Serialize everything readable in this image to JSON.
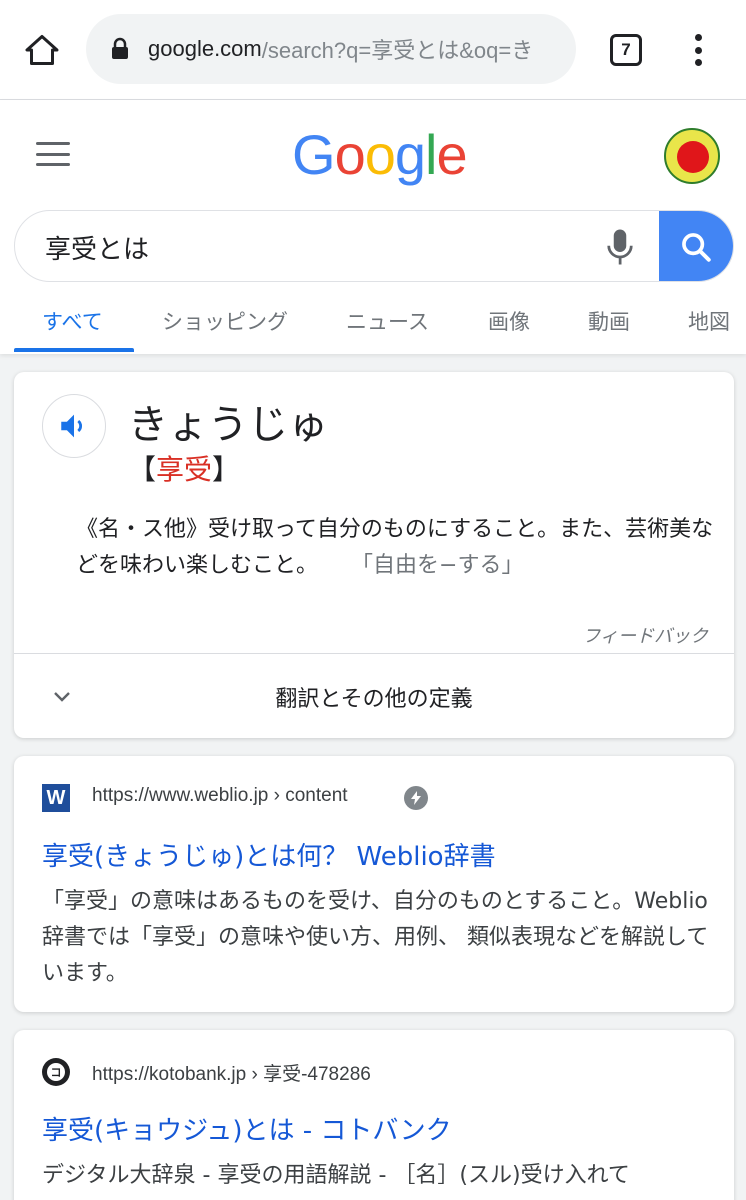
{
  "browser": {
    "url_host": "google.com",
    "url_rest": "/search?q=享受とは&oq=き",
    "tab_count": "7"
  },
  "google": {
    "logo": [
      "G",
      "o",
      "o",
      "g",
      "l",
      "e"
    ],
    "logo_colors": [
      "#4285f4",
      "#ea4335",
      "#fbbc05",
      "#4285f4",
      "#34a853",
      "#ea4335"
    ],
    "search_query": "享受とは",
    "tabs": [
      {
        "label": "すべて",
        "active": true
      },
      {
        "label": "ショッピング",
        "active": false
      },
      {
        "label": "ニュース",
        "active": false
      },
      {
        "label": "画像",
        "active": false
      },
      {
        "label": "動画",
        "active": false
      },
      {
        "label": "地図",
        "active": false
      }
    ]
  },
  "dictionary": {
    "reading": "きょうじゅ",
    "bracket_open": "【",
    "kanji": "享受",
    "bracket_close": "】",
    "definition": "《名・ス他》受け取って自分のものにすること。また、芸術美などを味わい楽しむこと。",
    "example": "「自由を−する」",
    "feedback": "フィードバック",
    "more_definitions": "翻訳とその他の定義"
  },
  "results": [
    {
      "favicon": "W",
      "cite": "https://www.weblio.jp › content",
      "title": "享受(きょうじゅ)とは何？ Weblio辞書",
      "snippet": "「享受」の意味はあるものを受け、自分のものとすること。Weblio辞書では「享受」の意味や使い方、用例、 類似表現などを解説しています。"
    },
    {
      "favicon": "コ",
      "cite": "https://kotobank.jp › 享受-478286",
      "title": "享受(キョウジュ)とは - コトバンク",
      "snippet": "デジタル大辞泉 - 享受の用語解説 - ［名］(スル)受け入れて"
    }
  ],
  "colors": {
    "link": "#1558d6",
    "accent": "#1a73e8",
    "search_button": "#4285f4",
    "kanji_red": "#d93025"
  }
}
